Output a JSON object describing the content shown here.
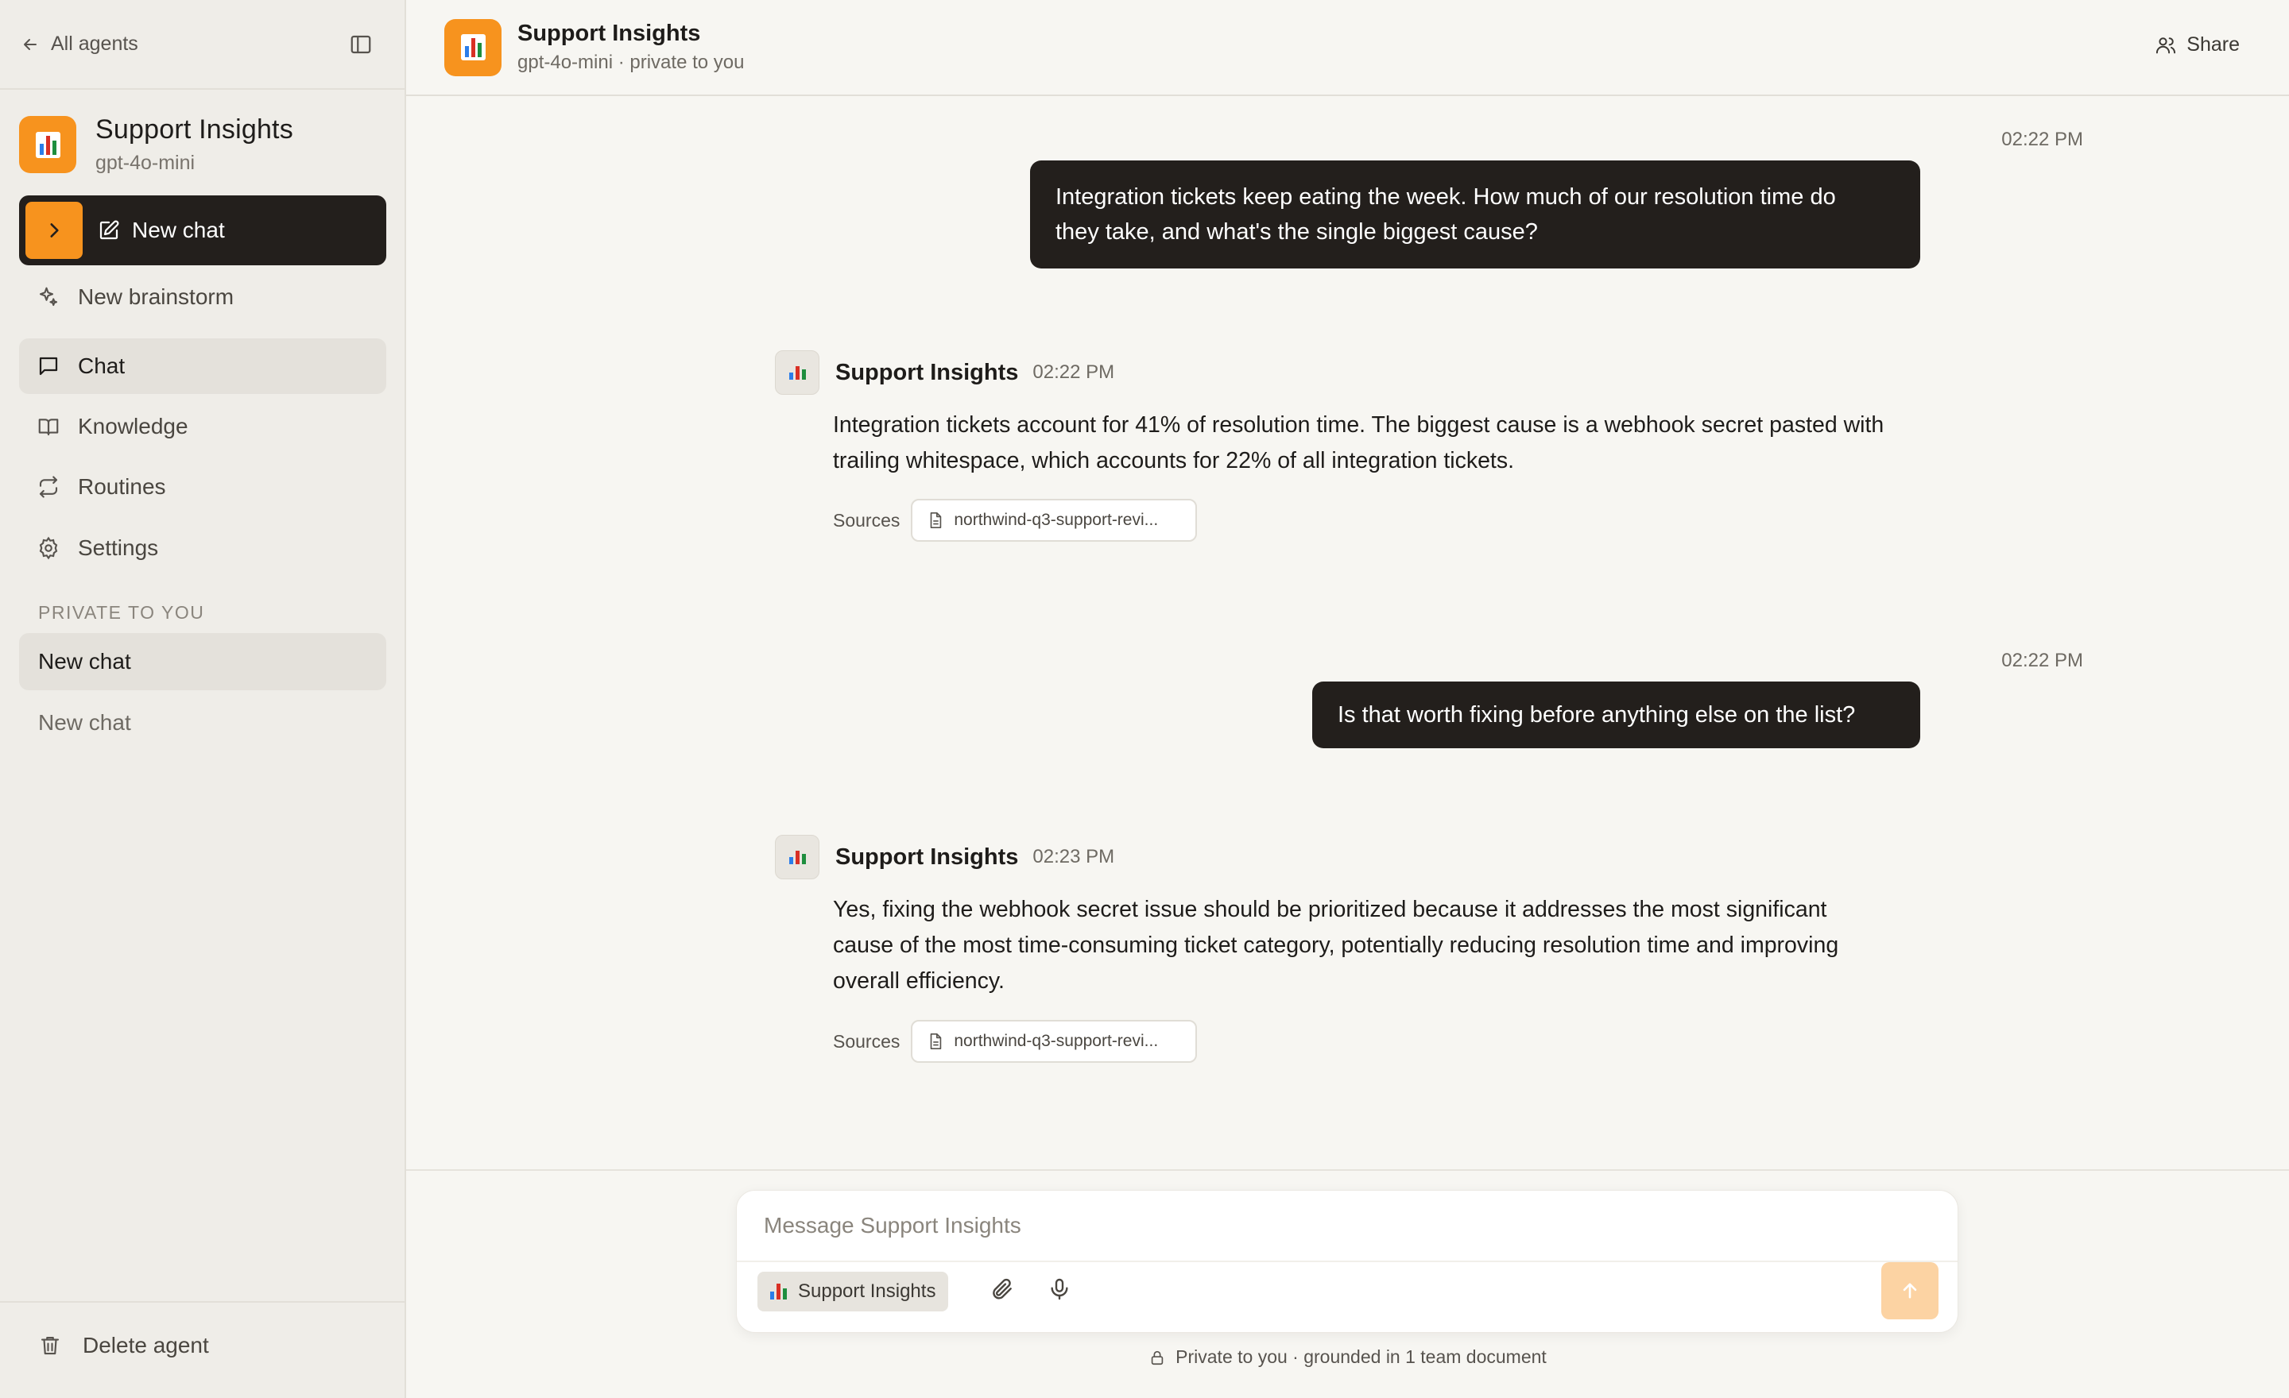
{
  "sidebar": {
    "back_label": "All agents",
    "agent": {
      "name": "Support Insights",
      "model": "gpt-4o-mini"
    },
    "new_chat_label": "New chat",
    "nav": [
      {
        "label": "New brainstorm",
        "icon": "sparkle-icon"
      },
      {
        "label": "Chat",
        "icon": "chat-bubble-icon",
        "active": true
      },
      {
        "label": "Knowledge",
        "icon": "book-icon"
      },
      {
        "label": "Routines",
        "icon": "repeat-icon"
      },
      {
        "label": "Settings",
        "icon": "gear-icon"
      }
    ],
    "section_label": "PRIVATE TO YOU",
    "chats": [
      {
        "label": "New chat",
        "active": true
      },
      {
        "label": "New chat",
        "active": false
      }
    ],
    "delete_label": "Delete agent"
  },
  "header": {
    "title": "Support Insights",
    "subtitle": "gpt-4o-mini · private to you",
    "share_label": "Share"
  },
  "messages": [
    {
      "role": "user",
      "time": "02:22 PM",
      "lines": [
        "Integration tickets keep eating the week. How much of our resolution time do",
        "they take, and what's the single biggest cause?"
      ]
    },
    {
      "role": "assistant",
      "name": "Support Insights",
      "time": "02:22 PM",
      "lines": [
        "Integration tickets account for 41% of resolution time. The biggest cause is a webhook secret pasted with",
        "trailing whitespace, which accounts for 22% of all integration tickets."
      ],
      "sources_label": "Sources",
      "source": "northwind-q3-support-revi..."
    },
    {
      "role": "user",
      "time": "02:22 PM",
      "lines": [
        "Is that worth fixing before anything else on the list?"
      ]
    },
    {
      "role": "assistant",
      "name": "Support Insights",
      "time": "02:23 PM",
      "lines": [
        "Yes, fixing the webhook secret issue should be prioritized because it addresses the most significant",
        "cause of the most time-consuming ticket category, potentially reducing resolution time and improving",
        "overall efficiency."
      ],
      "sources_label": "Sources",
      "source": "northwind-q3-support-revi..."
    }
  ],
  "composer": {
    "placeholder": "Message Support Insights",
    "agent_chip": "Support Insights",
    "footnote": "Private to you · grounded in 1 team document"
  },
  "colors": {
    "accent": "#f7931e",
    "dark": "#231f1c",
    "send_disabled": "#fcd3a3"
  }
}
